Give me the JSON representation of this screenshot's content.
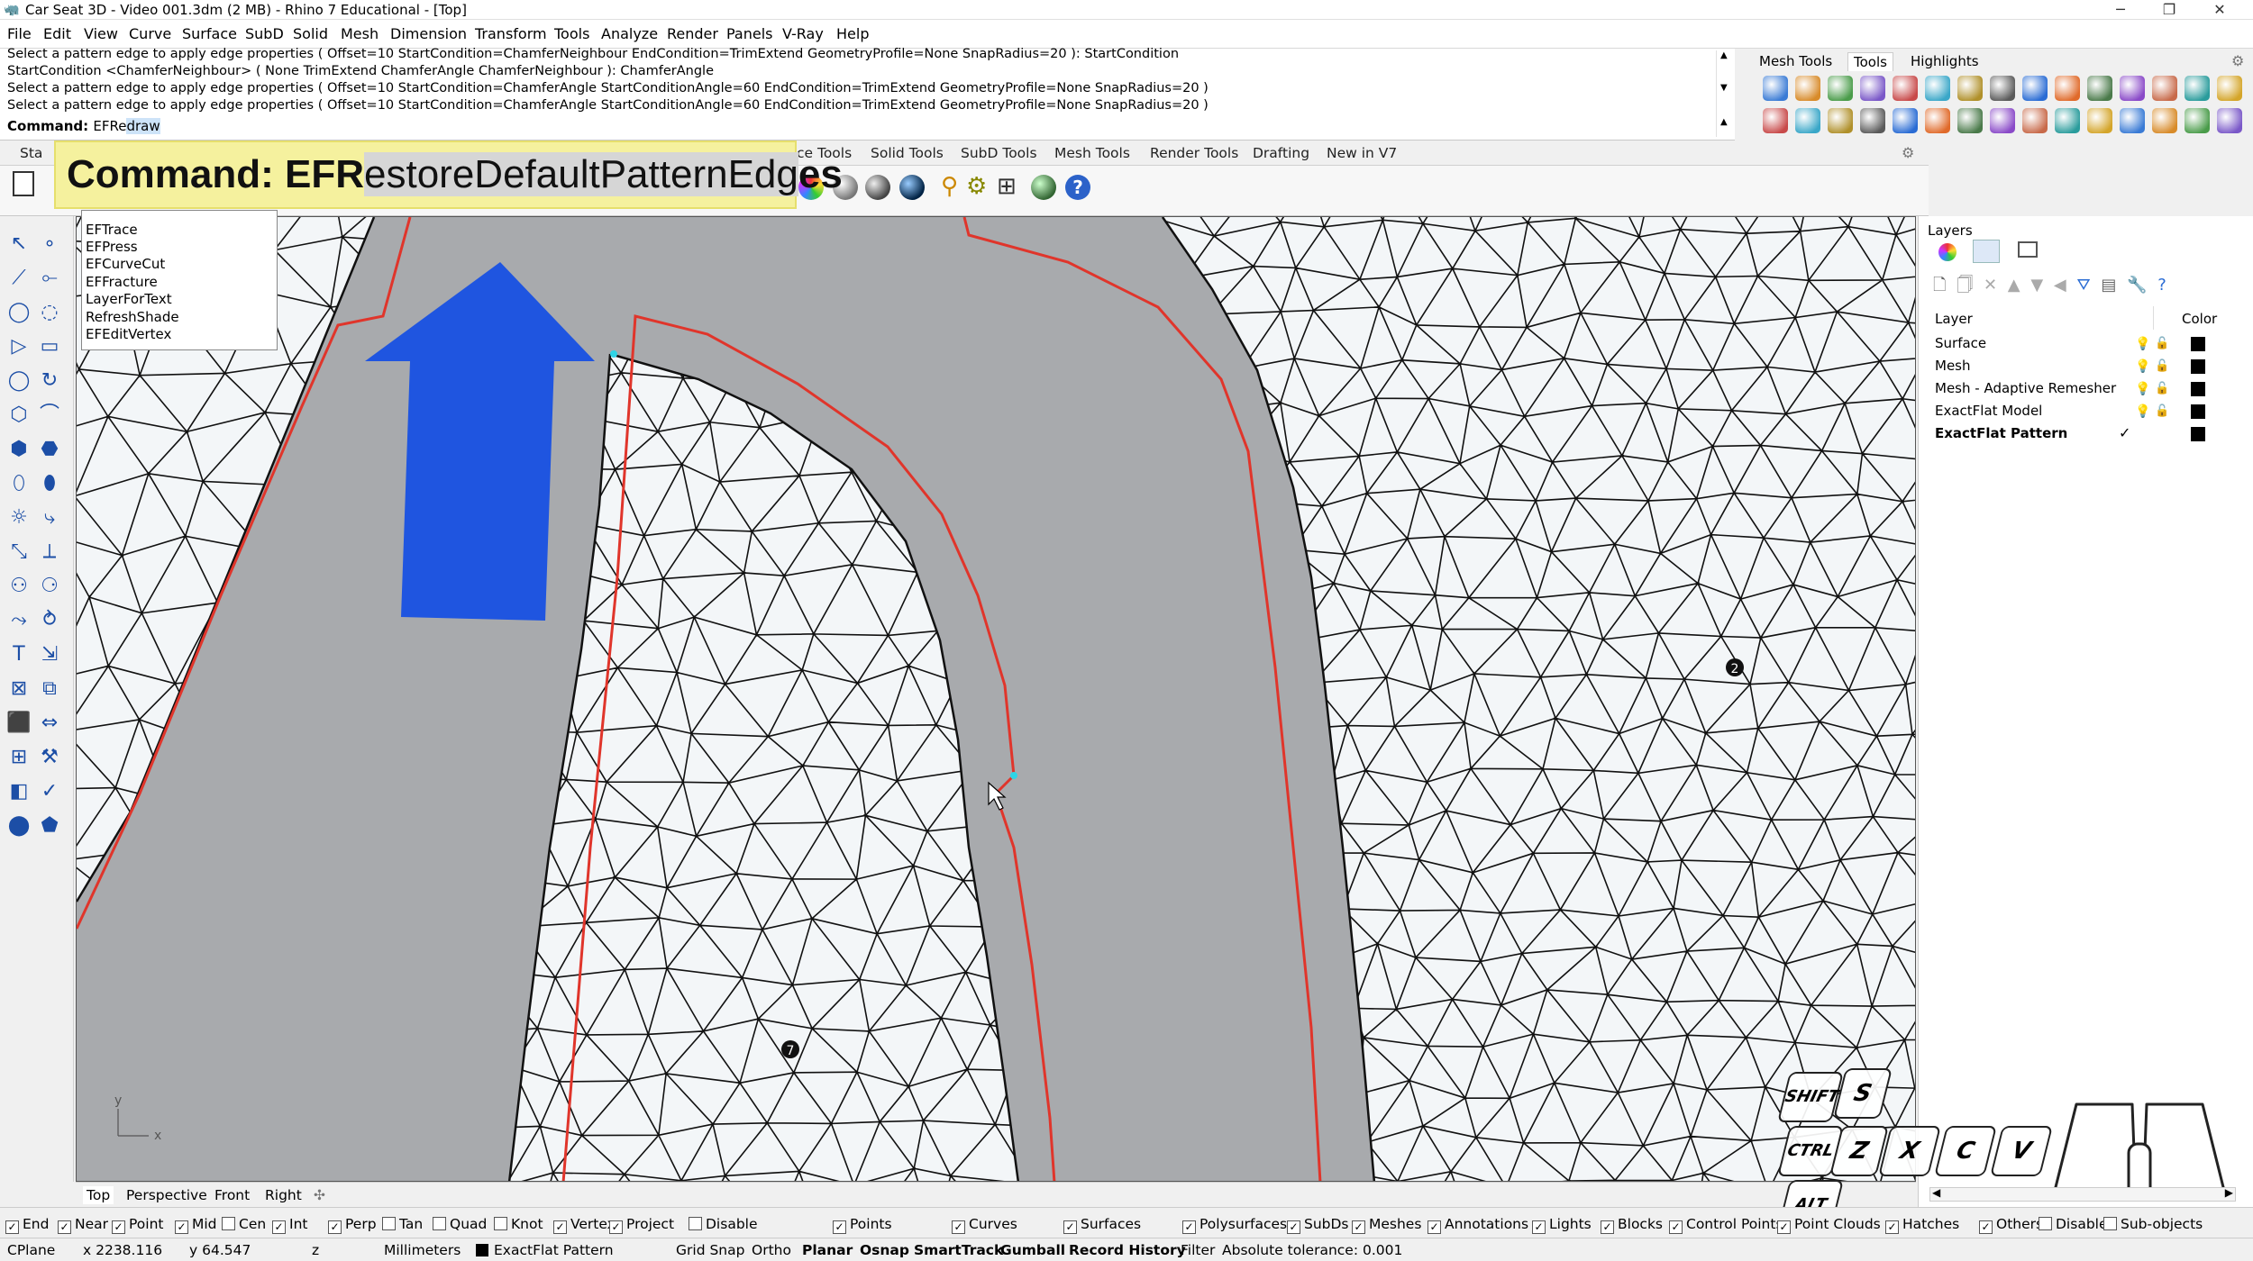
{
  "window": {
    "title": "Car Seat 3D - Video 001.3dm (2 MB) - Rhino 7 Educational - [Top]",
    "controls": [
      "─",
      "❐",
      "✕"
    ]
  },
  "menu": [
    "File",
    "Edit",
    "View",
    "Curve",
    "Surface",
    "SubD",
    "Solid",
    "Mesh",
    "Dimension",
    "Transform",
    "Tools",
    "Analyze",
    "Render",
    "Panels",
    "V-Ray",
    "Help"
  ],
  "command_history": [
    "Select a pattern edge to apply edge properties ( Offset=10  StartCondition=ChamferNeighbour  EndCondition=TrimExtend  GeometryProfile=None  SnapRadius=20 ): StartCondition",
    "StartCondition <ChamferNeighbour> ( None  TrimExtend  ChamferAngle  ChamferNeighbour ): ChamferAngle",
    "Select a pattern edge to apply edge properties ( Offset=10  StartCondition=ChamferAngle  StartConditionAngle=60  EndCondition=TrimExtend  GeometryProfile=None  SnapRadius=20 )",
    "Select a pattern edge to apply edge properties ( Offset=10  StartCondition=ChamferAngle  StartConditionAngle=60  EndCondition=TrimExtend  GeometryProfile=None  SnapRadius=20 )"
  ],
  "command_prompt": {
    "label": "Command:",
    "typed": "EFRe",
    "selected": "draw"
  },
  "right_toolbar_tabs": [
    "Mesh Tools",
    "Tools",
    "Highlights"
  ],
  "toolbar_tabs": [
    "Sta",
    "ce Tools",
    "Solid Tools",
    "SubD Tools",
    "Mesh Tools",
    "Render Tools",
    "Drafting",
    "New in V7"
  ],
  "banner": {
    "prefix": "Command: EFR",
    "selected": "estoreDefaultPatternEdg",
    "suffix": "es"
  },
  "autocomplete": [
    "EFTrace",
    "EFPress",
    "EFCurveCut",
    "EFFracture",
    "LayerForText",
    "RefreshShade",
    "EFEditVertex"
  ],
  "viewport": {
    "axis_y": "y",
    "axis_x": "x",
    "markers": [
      "2",
      "7"
    ],
    "arrow_color": "#1f55e0",
    "curve_color": "#e0352b"
  },
  "viewport_tabs": [
    "Top",
    "Perspective",
    "Front",
    "Right",
    "✣"
  ],
  "layers": {
    "title": "Layers",
    "header_layer": "Layer",
    "header_color": "Color",
    "rows": [
      {
        "name": "Surface",
        "current": false
      },
      {
        "name": "Mesh",
        "current": false
      },
      {
        "name": "Mesh - Adaptive Remesher",
        "current": false
      },
      {
        "name": "ExactFlat Model",
        "current": false
      },
      {
        "name": "ExactFlat Pattern",
        "current": true
      }
    ],
    "current_mark": "✓"
  },
  "keys": {
    "shift": "SHIFT",
    "ctrl": "CTRL",
    "alt": "ALT",
    "s": "S",
    "z": "Z",
    "x": "X",
    "c": "C",
    "v": "V"
  },
  "osnaps": [
    {
      "label": "End",
      "checked": true
    },
    {
      "label": "Near",
      "checked": true
    },
    {
      "label": "Point",
      "checked": true
    },
    {
      "label": "Mid",
      "checked": true
    },
    {
      "label": "Cen",
      "checked": false
    },
    {
      "label": "Int",
      "checked": true
    },
    {
      "label": "Perp",
      "checked": true
    },
    {
      "label": "Tan",
      "checked": false
    },
    {
      "label": "Quad",
      "checked": false
    },
    {
      "label": "Knot",
      "checked": false
    },
    {
      "label": "Vertex",
      "checked": true
    },
    {
      "label": "Project",
      "checked": true
    },
    {
      "label": "Disable",
      "checked": false
    }
  ],
  "filters": [
    {
      "label": "Points",
      "checked": true
    },
    {
      "label": "Curves",
      "checked": true
    },
    {
      "label": "Surfaces",
      "checked": true
    },
    {
      "label": "Polysurfaces",
      "checked": true
    },
    {
      "label": "SubDs",
      "checked": true
    },
    {
      "label": "Meshes",
      "checked": true
    },
    {
      "label": "Annotations",
      "checked": true
    },
    {
      "label": "Lights",
      "checked": true
    },
    {
      "label": "Blocks",
      "checked": true
    },
    {
      "label": "Control Points",
      "checked": true
    },
    {
      "label": "Point Clouds",
      "checked": true
    },
    {
      "label": "Hatches",
      "checked": true
    },
    {
      "label": "Others",
      "checked": true
    },
    {
      "label": "Disable",
      "checked": false
    },
    {
      "label": "Sub-objects",
      "checked": false
    }
  ],
  "status": {
    "cplane": "CPlane",
    "x": "x 2238.116",
    "y": "y 64.547",
    "z": "z",
    "units": "Millimeters",
    "layer": "ExactFlat Pattern",
    "grid_snap": "Grid Snap",
    "ortho": "Ortho",
    "planar": "Planar",
    "osnap": "Osnap",
    "smarttrack": "SmartTrack",
    "gumball": "Gumball",
    "record_history": "Record History",
    "filter": "Filter",
    "tolerance": "Absolute tolerance: 0.001"
  }
}
